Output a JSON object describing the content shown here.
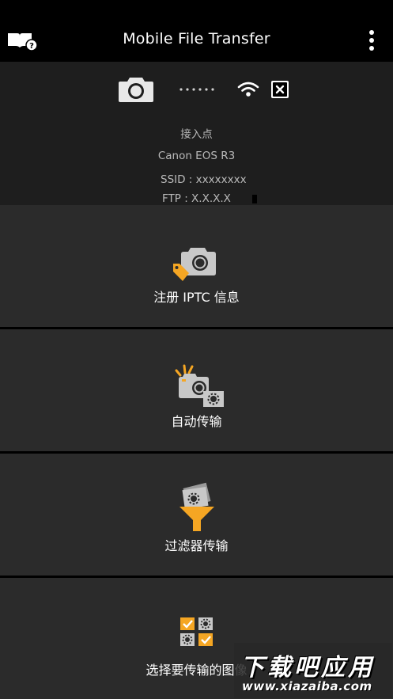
{
  "app": {
    "title": "Mobile File Transfer"
  },
  "header": {
    "help_icon": "help-book-icon",
    "menu_icon": "more-vertical-icon"
  },
  "status": {
    "access_point_label": "接入点",
    "camera_model": "Canon EOS R3",
    "ssid": "SSID : xxxxxxxx",
    "ftp": "FTP : X.X.X.X",
    "camera_icon": "camera-icon",
    "wifi_icon": "wifi-icon",
    "close_icon": "close-icon"
  },
  "tiles": [
    {
      "label": "注册 IPTC 信息",
      "icon": "iptc-camera-tag-icon"
    },
    {
      "label": "自动传输",
      "icon": "auto-transfer-camera-icon"
    },
    {
      "label": "过滤器传输",
      "icon": "filter-transfer-icon"
    },
    {
      "label": "选择要传输的图像",
      "icon": "select-images-grid-icon"
    }
  ],
  "watermark": {
    "line1": "下载吧应用",
    "line2": "www.xiazaiba.com"
  },
  "colors": {
    "accent": "#f5a623",
    "tile": "#2b2b2b",
    "status_bg": "#1e1e1e"
  }
}
